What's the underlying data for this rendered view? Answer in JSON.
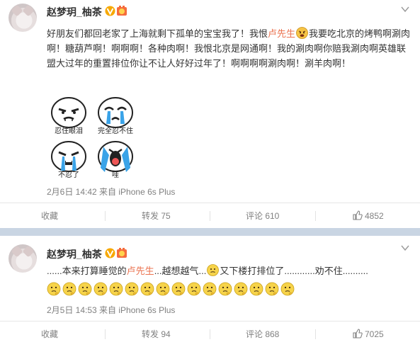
{
  "posts": [
    {
      "username": "赵梦玥_柚茶",
      "level_badge": "lv-badge",
      "verified_badge": "v-badge",
      "text_parts": {
        "p1": "好朋友们都回老家了上海就剩下孤单的宝宝我了！我恨",
        "mention": "卢先生",
        "p2": "我要吃北京的烤鸭啊涮肉啊！糖葫芦啊！啊啊啊！各种肉啊！我恨北京是网通啊！我的涮肉啊你赔我涮肉啊英雄联盟大过年的重置排位你让不让人好好过年了！啊啊啊啊涮肉啊！涮羊肉啊！"
      },
      "stickers": [
        {
          "caption": "忍住眼泪"
        },
        {
          "caption": "完全忍不住"
        },
        {
          "caption": "不忍了"
        },
        {
          "caption": "哇"
        }
      ],
      "meta": "2月6日 14:42 来自 iPhone 6s Plus",
      "actions": {
        "favorite": "收藏",
        "repost": "转发 75",
        "comment": "评论 610",
        "like": "4852"
      }
    },
    {
      "username": "赵梦玥_柚茶",
      "text_parts": {
        "p1": "......本来打算睡觉的",
        "mention": "卢先生",
        "p2": "...越想越气...",
        "p3": "又下楼打排位了............劝不住.........."
      },
      "emoji_count": 16,
      "meta": "2月5日 14:53 来自 iPhone 6s Plus",
      "actions": {
        "favorite": "收藏",
        "repost": "转发 94",
        "comment": "评论 868",
        "like": "7025"
      }
    }
  ],
  "colors": {
    "mention": "#eb7350",
    "verified": "#f7a800",
    "separator_band": "#c9d5e3",
    "meta_text": "#808080"
  },
  "icons": {
    "chevron": "chevron-down-icon",
    "like": "thumbs-up-icon",
    "angry": "angry-face-icon",
    "doubt": "thinking-face-icon"
  }
}
